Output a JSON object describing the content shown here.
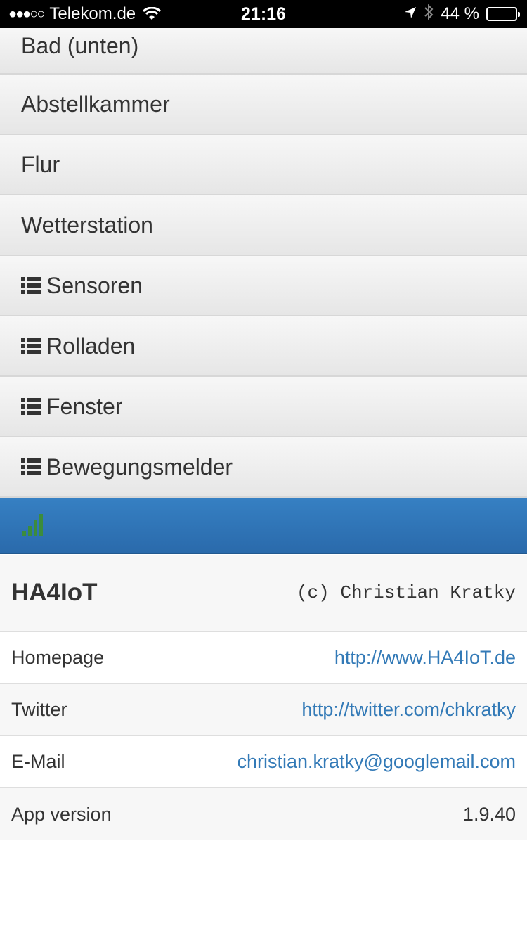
{
  "status_bar": {
    "signal": "●●●○○",
    "carrier": "Telekom.de",
    "time": "21:16",
    "battery_text": "44 %",
    "battery_level": 0.44
  },
  "menu": {
    "items": [
      {
        "label": "Bad (unten)",
        "icon": null
      },
      {
        "label": "Abstellkammer",
        "icon": null
      },
      {
        "label": "Flur",
        "icon": null
      },
      {
        "label": "Wetterstation",
        "icon": null
      },
      {
        "label": "Sensoren",
        "icon": "list-icon"
      },
      {
        "label": "Rolladen",
        "icon": "list-icon"
      },
      {
        "label": "Fenster",
        "icon": "list-icon"
      },
      {
        "label": "Bewegungsmelder",
        "icon": "list-icon"
      }
    ]
  },
  "bluebar": {
    "icon": "signal-bars-icon",
    "accent": "#2f74b7",
    "icon_color": "#3c8c3c"
  },
  "info": {
    "title": "HA4IoT",
    "copyright": "(c) Christian Kratky",
    "rows": [
      {
        "label": "Homepage",
        "value": "http://www.HA4IoT.de"
      },
      {
        "label": "Twitter",
        "value": "http://twitter.com/chkratky"
      },
      {
        "label": "E-Mail",
        "value": "christian.kratky@googlemail.com"
      },
      {
        "label": "App version",
        "value": "1.9.40"
      }
    ]
  },
  "colors": {
    "link": "#337ab7",
    "menu_bg": "#efefef"
  }
}
